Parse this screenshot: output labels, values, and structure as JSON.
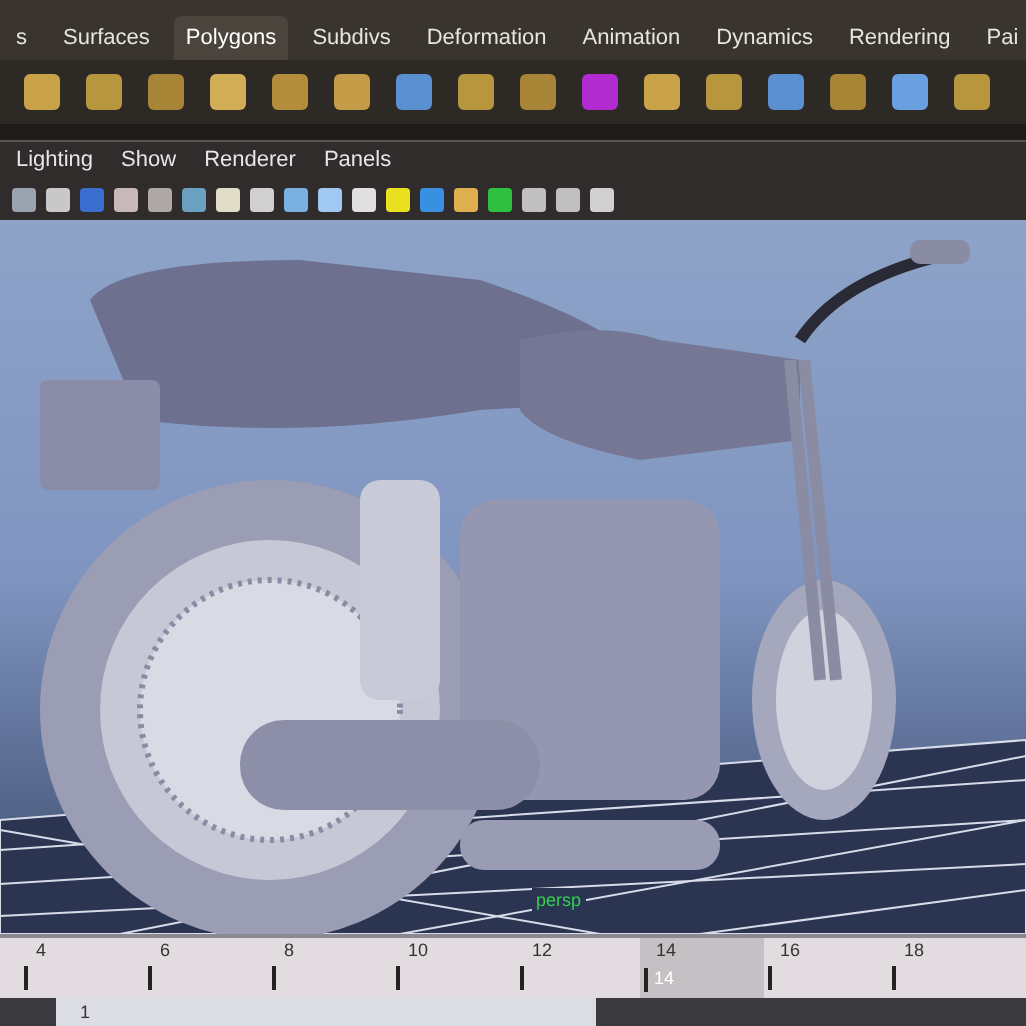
{
  "shelf_tabs": [
    {
      "label": "s",
      "selected": false
    },
    {
      "label": "Surfaces",
      "selected": false
    },
    {
      "label": "Polygons",
      "selected": true
    },
    {
      "label": "Subdivs",
      "selected": false
    },
    {
      "label": "Deformation",
      "selected": false
    },
    {
      "label": "Animation",
      "selected": false
    },
    {
      "label": "Dynamics",
      "selected": false
    },
    {
      "label": "Rendering",
      "selected": false
    },
    {
      "label": "Pai",
      "selected": false
    }
  ],
  "panel_menu": [
    "Lighting",
    "Show",
    "Renderer",
    "Panels"
  ],
  "viewport": {
    "camera_label": "persp"
  },
  "time_slider": {
    "ticks": [
      {
        "label": "4",
        "selected": false
      },
      {
        "label": "6",
        "selected": false
      },
      {
        "label": "8",
        "selected": false
      },
      {
        "label": "10",
        "selected": false
      },
      {
        "label": "12",
        "selected": false
      },
      {
        "label": "14",
        "selected": true
      },
      {
        "label": "16",
        "selected": false
      },
      {
        "label": "18",
        "selected": false
      }
    ],
    "current_frame": "14"
  },
  "range_field": {
    "value": "1"
  }
}
